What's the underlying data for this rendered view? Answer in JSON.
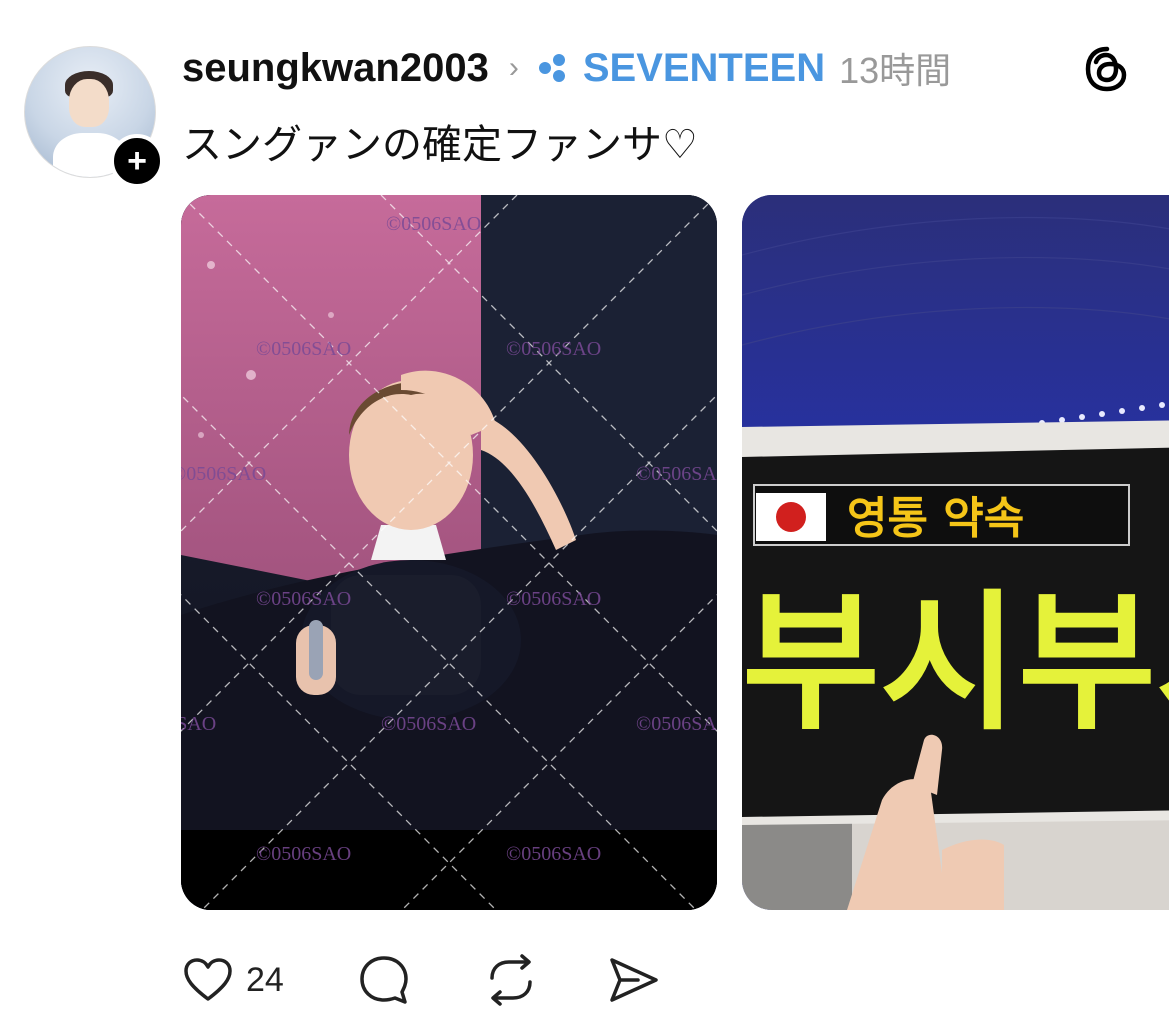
{
  "post": {
    "username": "seungkwan2003",
    "community": "SEVENTEEN",
    "time_ago": "13時間",
    "text": "スングァンの確定ファンサ♡",
    "watermark": "©0506SAO",
    "images": [
      {
        "label": ""
      },
      {
        "banner_top": "영통 약속",
        "banner_main": "부시부시"
      }
    ]
  },
  "actions": {
    "like_count": "24"
  },
  "colors": {
    "community_accent": "#4a96e0",
    "muted_text": "#999999"
  },
  "icons": {
    "follow": "plus-icon",
    "chevron": "chevron-right-icon",
    "community": "community-icon",
    "app": "threads-icon",
    "like": "heart-icon",
    "comment": "comment-icon",
    "repost": "repost-icon",
    "share": "share-icon"
  }
}
